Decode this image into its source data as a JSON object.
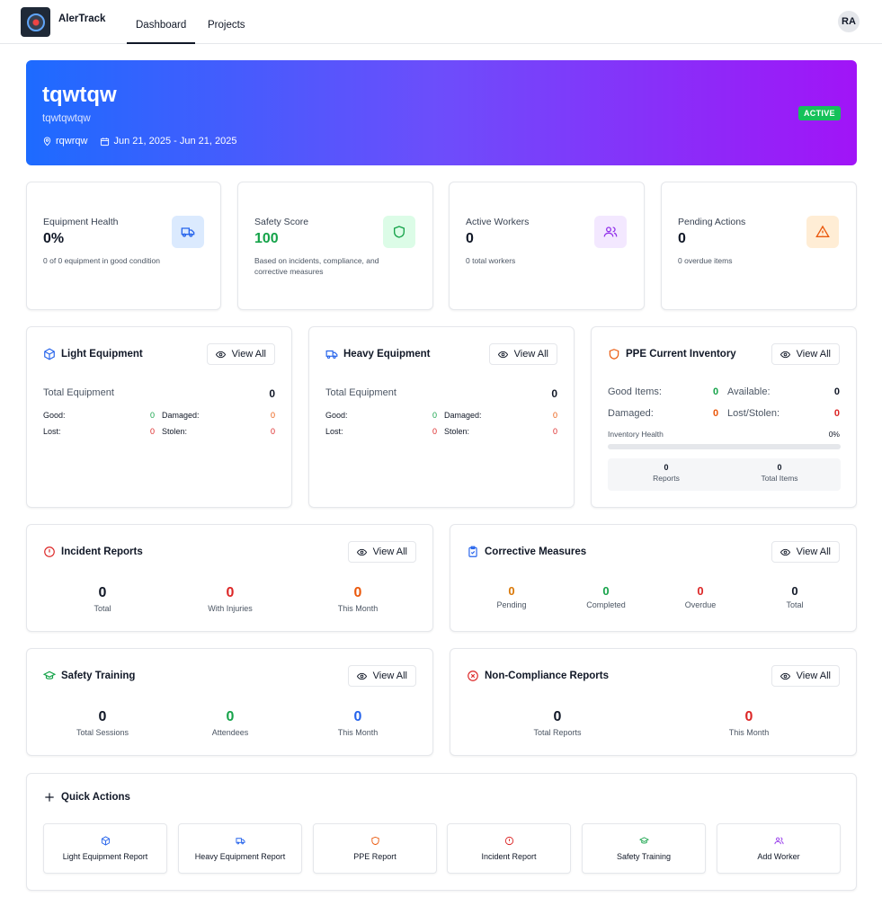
{
  "nav": {
    "app_name": "AlerTrack",
    "tabs": [
      "Dashboard",
      "Projects"
    ],
    "avatar_initials": "RA"
  },
  "project": {
    "title": "tqwtqw",
    "subtitle": "tqwtqwtqw",
    "location": "rqwrqw",
    "dates": "Jun 21, 2025 - Jun 21, 2025",
    "status": "ACTIVE"
  },
  "stats": [
    {
      "label": "Equipment Health",
      "value": "0%",
      "desc": "0 of 0 equipment in good condition",
      "icon": "truck-icon",
      "color": "#2563eb"
    },
    {
      "label": "Safety Score",
      "value": "100",
      "desc": "Based on incidents, compliance, and corrective measures",
      "icon": "shield-icon",
      "color": "#16a34a"
    },
    {
      "label": "Active Workers",
      "value": "0",
      "desc": "0 total workers",
      "icon": "users-icon",
      "color": "#9333ea"
    },
    {
      "label": "Pending Actions",
      "value": "0",
      "desc": "0 overdue items",
      "icon": "alert-triangle-icon",
      "color": "#ea580c"
    }
  ],
  "view_all_label": "View All",
  "light_equipment": {
    "title": "Light Equipment",
    "total_label": "Total Equipment",
    "total": "0",
    "good_label": "Good:",
    "good": "0",
    "damaged_label": "Damaged:",
    "damaged": "0",
    "lost_label": "Lost:",
    "lost": "0",
    "stolen_label": "Stolen:",
    "stolen": "0"
  },
  "heavy_equipment": {
    "title": "Heavy Equipment",
    "total_label": "Total Equipment",
    "total": "0",
    "good_label": "Good:",
    "good": "0",
    "damaged_label": "Damaged:",
    "damaged": "0",
    "lost_label": "Lost:",
    "lost": "0",
    "stolen_label": "Stolen:",
    "stolen": "0"
  },
  "ppe": {
    "title": "PPE Current Inventory",
    "good_label": "Good Items:",
    "good": "0",
    "available_label": "Available:",
    "available": "0",
    "damaged_label": "Damaged:",
    "damaged": "0",
    "lost_label": "Lost/Stolen:",
    "lost": "0",
    "health_label": "Inventory Health",
    "health": "0%",
    "health_fraction": 0,
    "reports": "0",
    "reports_label": "Reports",
    "total_items": "0",
    "total_items_label": "Total Items"
  },
  "incidents": {
    "title": "Incident Reports",
    "total": "0",
    "total_label": "Total",
    "injuries": "0",
    "injuries_label": "With Injuries",
    "month": "0",
    "month_label": "This Month"
  },
  "corrective": {
    "title": "Corrective Measures",
    "pending": "0",
    "pending_label": "Pending",
    "completed": "0",
    "completed_label": "Completed",
    "overdue": "0",
    "overdue_label": "Overdue",
    "total": "0",
    "total_label": "Total"
  },
  "training": {
    "title": "Safety Training",
    "sessions": "0",
    "sessions_label": "Total Sessions",
    "attendees": "0",
    "attendees_label": "Attendees",
    "month": "0",
    "month_label": "This Month"
  },
  "noncompliance": {
    "title": "Non-Compliance Reports",
    "total": "0",
    "total_label": "Total Reports",
    "month": "0",
    "month_label": "This Month"
  },
  "quick_actions": {
    "title": "Quick Actions",
    "items": [
      {
        "label": "Light Equipment Report",
        "icon": "box-icon",
        "color": "#2563eb"
      },
      {
        "label": "Heavy Equipment Report",
        "icon": "truck-icon",
        "color": "#2563eb"
      },
      {
        "label": "PPE Report",
        "icon": "shield-icon",
        "color": "#ea580c"
      },
      {
        "label": "Incident Report",
        "icon": "alert-circle-icon",
        "color": "#dc2626"
      },
      {
        "label": "Safety Training",
        "icon": "graduation-cap-icon",
        "color": "#16a34a"
      },
      {
        "label": "Add Worker",
        "icon": "users-icon",
        "color": "#9333ea"
      }
    ]
  }
}
